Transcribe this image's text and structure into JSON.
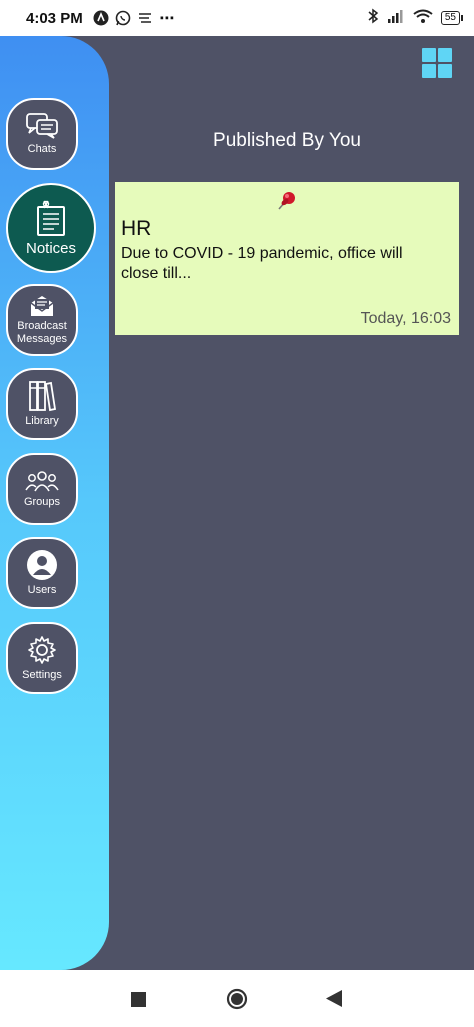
{
  "status_bar": {
    "time": "4:03 PM",
    "battery": "55",
    "icons": [
      "auto-icon",
      "whatsapp-icon",
      "notification-icon",
      "more-icon",
      "bluetooth-icon",
      "signal-icon",
      "wifi-icon",
      "battery-icon"
    ]
  },
  "sidebar": {
    "items": [
      {
        "label": "Chats",
        "icon": "chat-icon"
      },
      {
        "label": "Notices",
        "icon": "notice-icon",
        "active": true
      },
      {
        "label": "Broadcast Messages",
        "icon": "broadcast-icon"
      },
      {
        "label": "Library",
        "icon": "library-icon"
      },
      {
        "label": "Groups",
        "icon": "groups-icon"
      },
      {
        "label": "Users",
        "icon": "user-icon"
      },
      {
        "label": "Settings",
        "icon": "gear-icon"
      }
    ]
  },
  "main": {
    "title": "Published By You",
    "notices": [
      {
        "title": "HR",
        "body": "Due to COVID - 19 pandemic, office will close till...",
        "time": "Today, 16:03"
      }
    ]
  },
  "colors": {
    "sidebar_top": "#3f8ff2",
    "sidebar_bottom": "#66e8ff",
    "background": "#4f5266",
    "active_item": "#0d5a50",
    "card": "#e6fbbb",
    "grid_icon": "#5fd5f5"
  },
  "system_nav": [
    "recent-apps-icon",
    "home-icon",
    "back-icon"
  ]
}
